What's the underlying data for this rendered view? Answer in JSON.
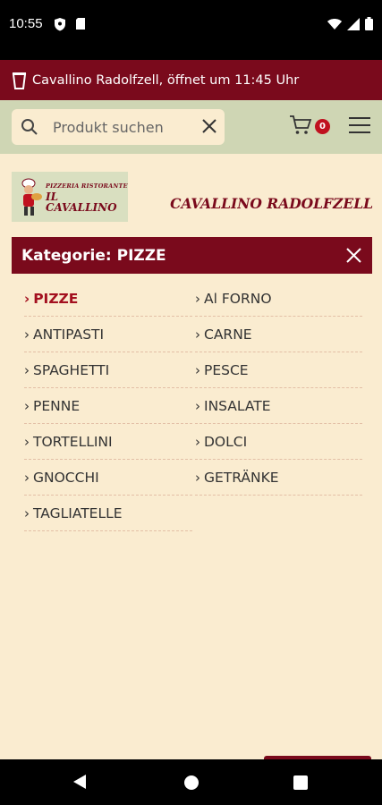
{
  "status_bar": {
    "time": "10:55"
  },
  "info_bar": {
    "text": "Cavallino Radolfzell, öffnet um 11:45 Uhr",
    "icon": "cup-icon"
  },
  "search": {
    "placeholder": "Produkt suchen",
    "value": ""
  },
  "cart": {
    "count": "0"
  },
  "logo": {
    "small_text": "PIZZERIA RISTORANTE",
    "big_text": "IL CAVALLINO"
  },
  "brand": {
    "name": "CAVALLINO RADOLFZELL"
  },
  "category_panel": {
    "title": "Kategorie: PIZZE",
    "left_column": [
      {
        "label": "PIZZE",
        "active": true
      },
      {
        "label": "ANTIPASTI",
        "active": false
      },
      {
        "label": "SPAGHETTI",
        "active": false
      },
      {
        "label": "PENNE",
        "active": false
      },
      {
        "label": "TORTELLINI",
        "active": false
      },
      {
        "label": "GNOCCHI",
        "active": false
      },
      {
        "label": "TAGLIATELLE",
        "active": false
      }
    ],
    "right_column": [
      {
        "label": "Al FORNO",
        "active": false
      },
      {
        "label": "CARNE",
        "active": false
      },
      {
        "label": "PESCE",
        "active": false
      },
      {
        "label": "INSALATE",
        "active": false
      },
      {
        "label": "DOLCI",
        "active": false
      },
      {
        "label": "GETRÄNKE",
        "active": false
      }
    ]
  },
  "colors": {
    "primary": "#7a0a1c",
    "background": "#faecd0",
    "search_bar": "#cfd6b4",
    "active_text": "#a3101f",
    "badge": "#c0111f"
  }
}
